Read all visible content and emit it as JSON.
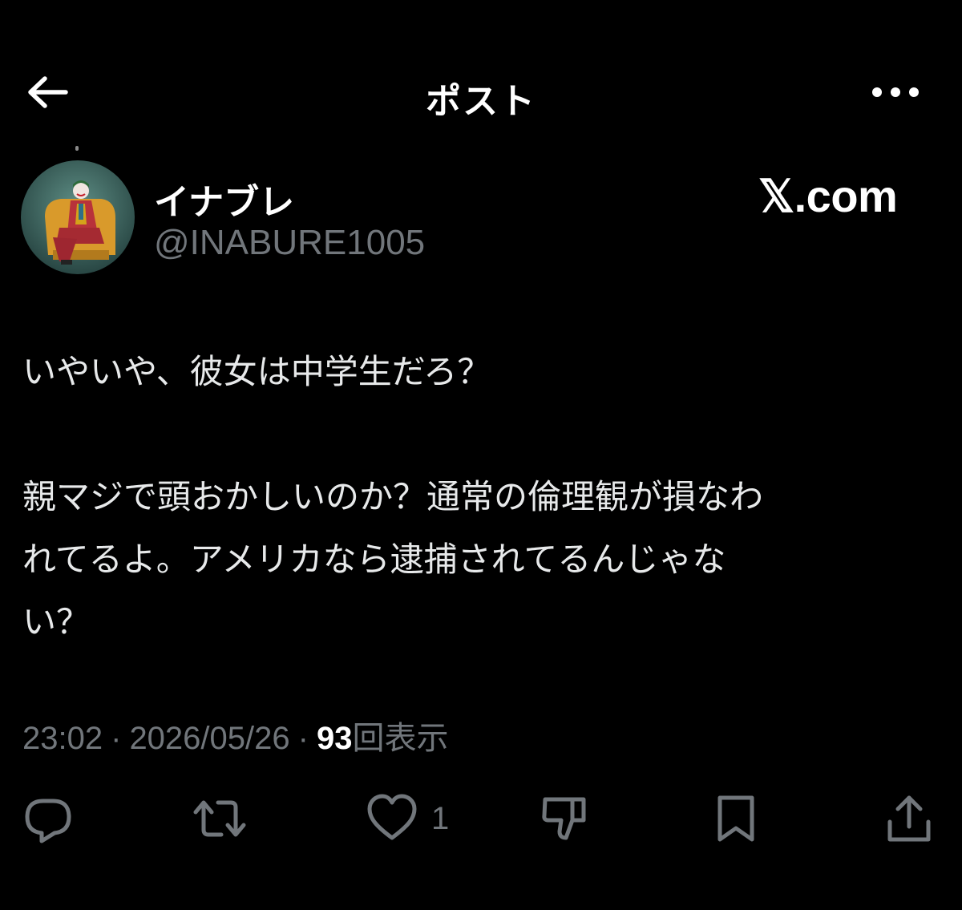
{
  "header": {
    "title": "ポスト",
    "back_icon": "arrow-left-icon",
    "more_icon": "more-horizontal-icon"
  },
  "author": {
    "name": "イナブレ",
    "handle": "@INABURE1005",
    "avatar": "joker-avatar"
  },
  "watermark": {
    "label": "𝕏.com"
  },
  "post": {
    "line1": "いやいや、彼女は中学生だろ？",
    "paragraph2_line1": "親マジで頭おかしいのか？通常の倫理観が損なわ",
    "paragraph2_line2": "れてるよ。アメリカなら逮捕されてるんじゃな",
    "paragraph2_line3": "い？"
  },
  "meta": {
    "time": "23:02",
    "date": "2026/05/26",
    "separator": "·",
    "views_count": "93",
    "views_label": "回表示"
  },
  "actions": {
    "reply_icon": "reply-icon",
    "repost_icon": "repost-icon",
    "like_icon": "heart-icon",
    "like_count": "1",
    "dislike_icon": "thumbs-down-icon",
    "bookmark_icon": "bookmark-icon",
    "share_icon": "share-icon"
  },
  "colors": {
    "background": "#000000",
    "text_primary": "#e7e9ea",
    "text_secondary": "#71767b",
    "white": "#ffffff"
  }
}
